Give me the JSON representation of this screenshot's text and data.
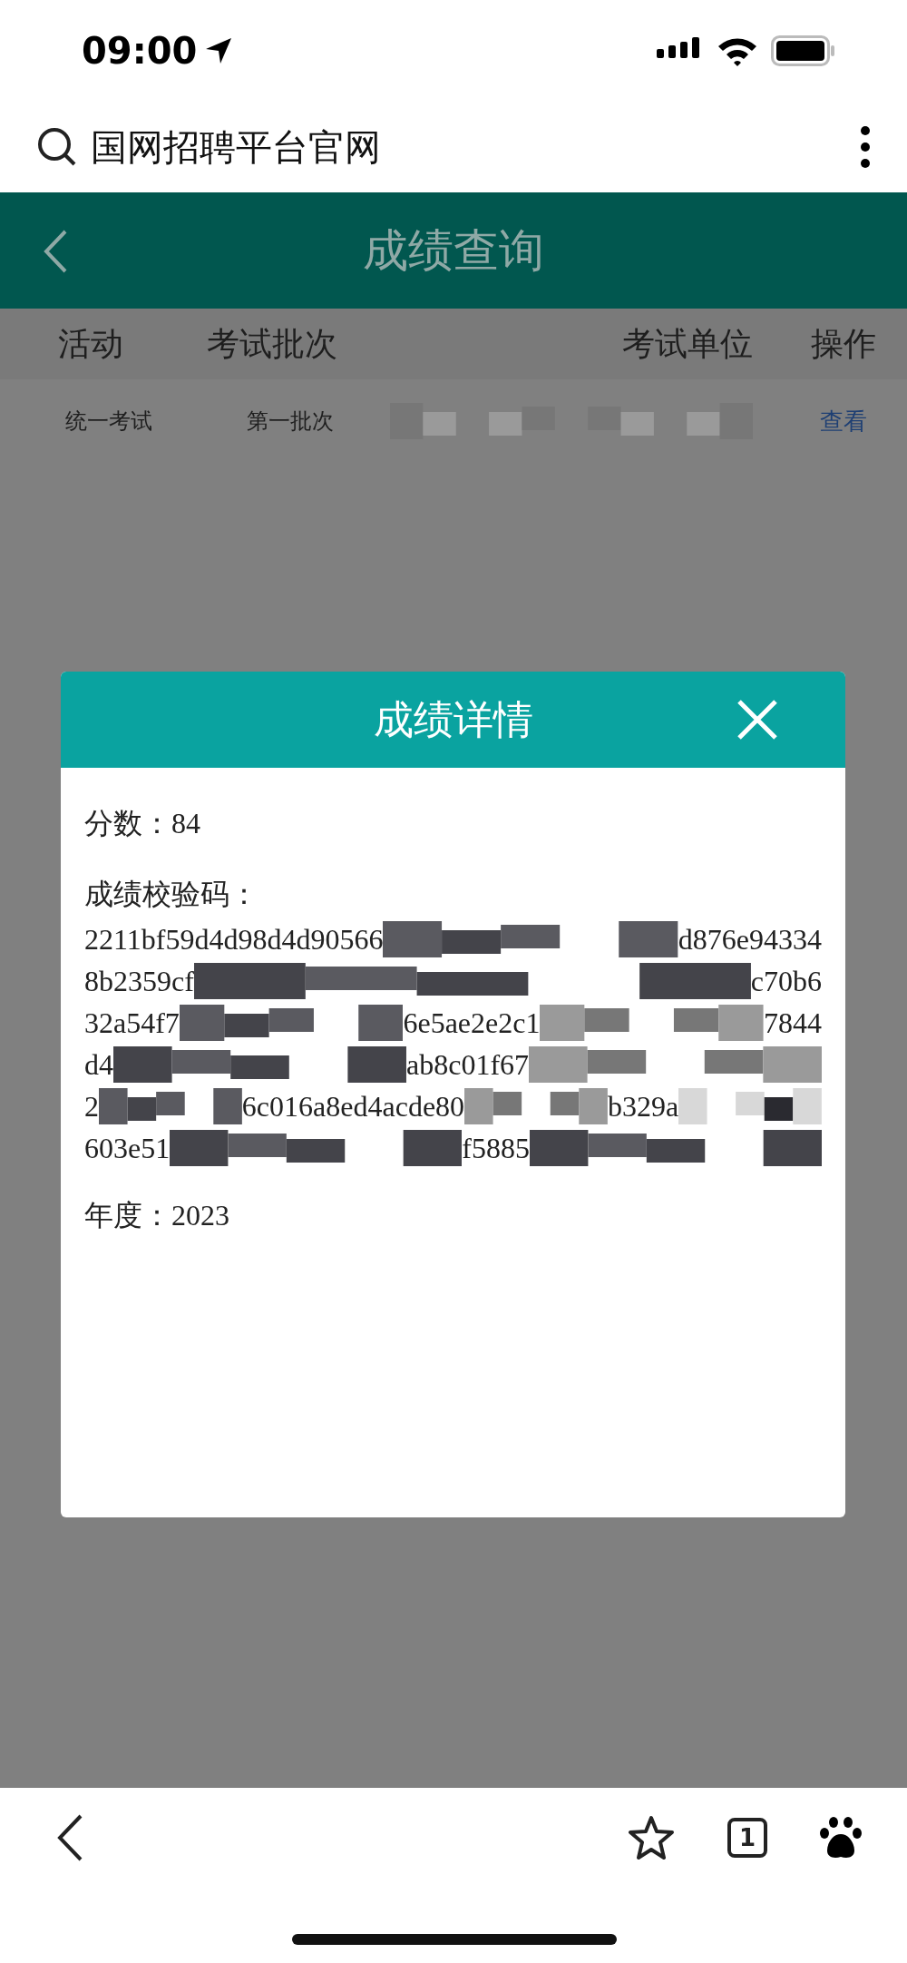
{
  "status_bar": {
    "time": "09:00"
  },
  "browser_bar": {
    "query": "国网招聘平台官网"
  },
  "header": {
    "title": "成绩查询"
  },
  "table": {
    "columns": [
      "活动",
      "考试批次",
      "考试单位",
      "操作"
    ],
    "rows": [
      {
        "activity": "统一考试",
        "batch": "第一批次",
        "action": "查看"
      }
    ]
  },
  "dialog": {
    "title": "成绩详情",
    "score_label": "分数：",
    "score": "84",
    "code_label": "成绩校验码：",
    "code_lines": [
      {
        "parts": [
          "2211bf59d4d98d4d90566",
          "d876e94334"
        ]
      },
      {
        "parts": [
          "8b2359cf",
          "c70b6"
        ]
      },
      {
        "parts": [
          "32a54f7",
          "6e5ae2e2c1",
          "7844"
        ]
      },
      {
        "parts": [
          "d4",
          "ab8c01f67"
        ]
      },
      {
        "parts": [
          "2",
          "6c016a8ed4acde80",
          "b329a"
        ]
      },
      {
        "parts": [
          "603e51",
          "f5885"
        ]
      }
    ],
    "year_label": "年度：",
    "year": "2023"
  },
  "toolbar": {
    "tab_count": "1"
  }
}
